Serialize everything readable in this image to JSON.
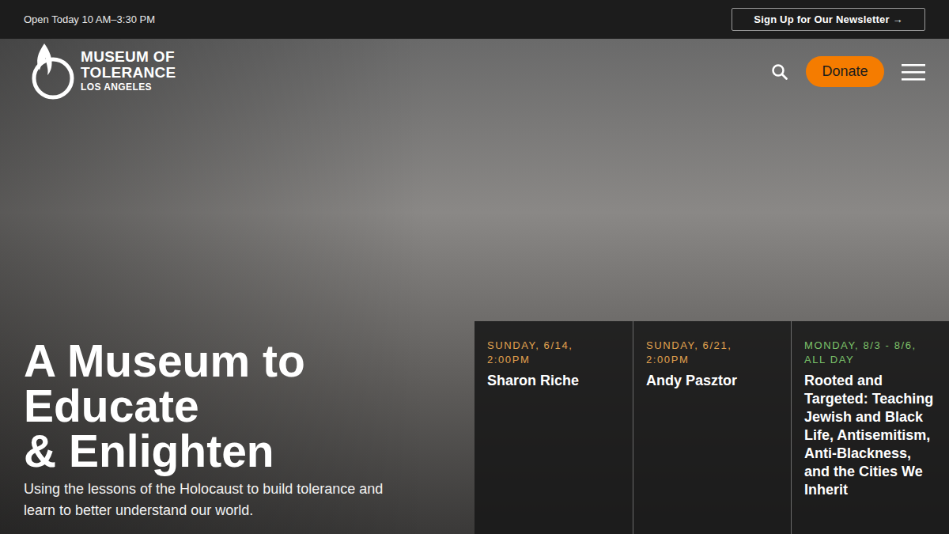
{
  "top_bar": {
    "hours": "Open Today 10 AM–3:30 PM",
    "newsletter_button": "Sign Up for Our Newsletter →"
  },
  "logo": {
    "lines": [
      "MUSEUM OF",
      "TOLERANCE",
      "LOS ANGELES"
    ]
  },
  "header": {
    "donate_button": "Donate"
  },
  "hero": {
    "headline_lines": [
      "A Museum to",
      "Educate",
      "& Enlighten"
    ],
    "subtitle": "Using the lessons of the Holocaust to build tolerance and learn to better understand our world."
  },
  "events": [
    {
      "date": "SUNDAY, 6/14, 2:00PM",
      "title": "Sharon Riche",
      "color": "#e3a34f"
    },
    {
      "date": "SUNDAY, 6/21, 2:00PM",
      "title": "Andy Pasztor",
      "color": "#e3a34f"
    },
    {
      "date": "MONDAY, 8/3 - 8/6, ALL DAY",
      "title": "Rooted and Targeted: Teaching Jewish and Black Life, Antisemitism, Anti-Blackness, and the Cities We Inherit",
      "color": "#7cc36a"
    }
  ]
}
